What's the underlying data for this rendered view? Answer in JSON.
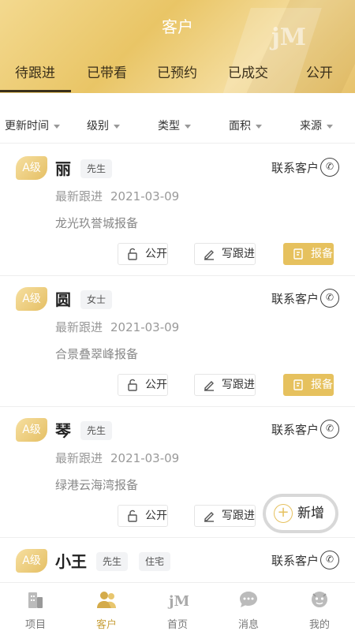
{
  "header": {
    "title": "客户",
    "tabs": [
      "待跟进",
      "已带看",
      "已预约",
      "已成交",
      "公开"
    ],
    "active_tab": 0
  },
  "filters": [
    "更新时间",
    "级别",
    "类型",
    "面积",
    "来源"
  ],
  "actions": {
    "contact_label": "联系客户",
    "public_label": "公开",
    "write_label": "写跟进",
    "report_label": "报备",
    "follow_label": "最新跟进"
  },
  "customers": [
    {
      "level": "A级",
      "name": "丽",
      "tags": [
        "先生"
      ],
      "date": "2021-03-09",
      "project": "龙光玖誉城报备"
    },
    {
      "level": "A级",
      "name": "圆",
      "tags": [
        "女士"
      ],
      "date": "2021-03-09",
      "project": "合景叠翠峰报备"
    },
    {
      "level": "A级",
      "name": "琴",
      "tags": [
        "先生"
      ],
      "date": "2021-03-09",
      "project": "绿港云海湾报备"
    },
    {
      "level": "A级",
      "name": "小王",
      "tags": [
        "先生",
        "住宅"
      ]
    }
  ],
  "fab_label": "新增",
  "tabbar": [
    {
      "label": "项目",
      "icon": "building-icon"
    },
    {
      "label": "客户",
      "icon": "users-icon"
    },
    {
      "label": "首页",
      "icon": "brand-logo-icon"
    },
    {
      "label": "消息",
      "icon": "message-icon"
    },
    {
      "label": "我的",
      "icon": "profile-icon"
    }
  ],
  "colors": {
    "accent": "#e6c15e",
    "header_gradient": "#e9c566",
    "active_tab": "#c9a23f"
  }
}
